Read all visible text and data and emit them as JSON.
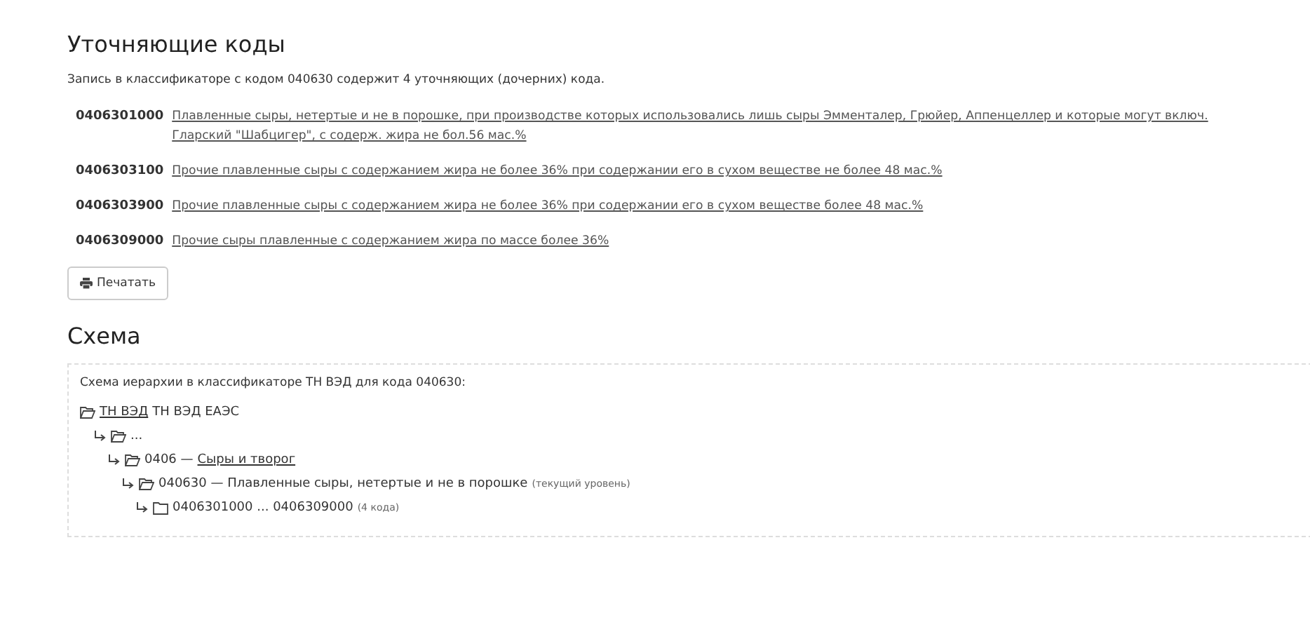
{
  "codes_section": {
    "title": "Уточняющие коды",
    "intro": "Запись в классификаторе с кодом 040630 содержит 4 уточняющих (дочерних) кода.",
    "codes": [
      {
        "code": "0406301000",
        "description": "Плавленные сыры, нетертые и не в порошке, при производстве которых использовались лишь сыры Эмменталер, Грюйер, Аппенцеллер и которые могут включ. Гларский \"Шабцигер\", с содерж. жира не бол.56 мас.%"
      },
      {
        "code": "0406303100",
        "description": "Прочие плавленные сыры с содержанием жира не более 36% при содержании его в сухом веществе не более 48 мас.%"
      },
      {
        "code": "0406303900",
        "description": "Прочие плавленные сыры с содержанием жира не более 36% при содержании его в сухом веществе более 48 мас.%"
      },
      {
        "code": "0406309000",
        "description": "Прочие сыры плавленные с содержанием жира по массе более 36%"
      }
    ],
    "print_button": "Печатать"
  },
  "scheme_section": {
    "title": "Схема",
    "caption": "Схема иерархии в классификаторе ТН ВЭД для кода 040630:",
    "tree": [
      {
        "open": true,
        "link": "ТН ВЭД",
        "text": "ТН ВЭД ЕАЭС",
        "children": [
          {
            "open": true,
            "text": "...",
            "children": [
              {
                "open": true,
                "prefix": "0406 —",
                "link": "Сыры и творог",
                "children": [
                  {
                    "open": true,
                    "text": "040630 — Плавленные сыры, нетертые и не в порошке",
                    "note": "(текущий уровень)",
                    "children": [
                      {
                        "open": false,
                        "text": "0406301000 ... 0406309000",
                        "note": "(4 кода)"
                      }
                    ]
                  }
                ]
              }
            ]
          }
        ]
      }
    ]
  }
}
